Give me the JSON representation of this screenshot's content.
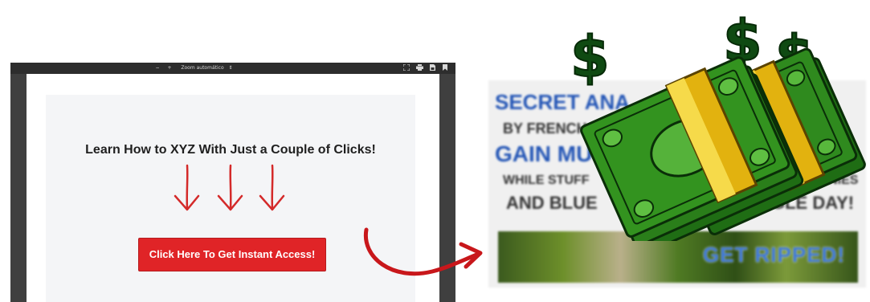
{
  "viewer": {
    "toolbar": {
      "zoom_out": "−",
      "zoom_in": "+",
      "zoom_value": "Zoom automático",
      "zoom_caret": "⇕",
      "fullscreen_icon": "fullscreen-icon",
      "print_icon": "print-icon",
      "save_icon": "save-icon",
      "bookmark_icon": "bookmark-icon"
    },
    "page": {
      "headline": "Learn How to XYZ With Just a Couple of Clicks!",
      "cta_label": "Click Here To Get Instant Access!",
      "cta_color": "#e02427"
    }
  },
  "ad": {
    "line1": "SECRET ANA",
    "line2": "BY FRENCH BO",
    "line3": "GAIN MU",
    "line3b": "ED",
    "line4": "WHILE STUFF",
    "line4b": "ROWNIES",
    "line5": "AND BLUE",
    "line5b": "INGLE DAY!",
    "image_title": "GET RIPPED!"
  },
  "colors": {
    "accent_red": "#e02427",
    "connector_red": "#c8171b",
    "money_green": "#2f8a1e",
    "band_yellow": "#f0c419"
  }
}
